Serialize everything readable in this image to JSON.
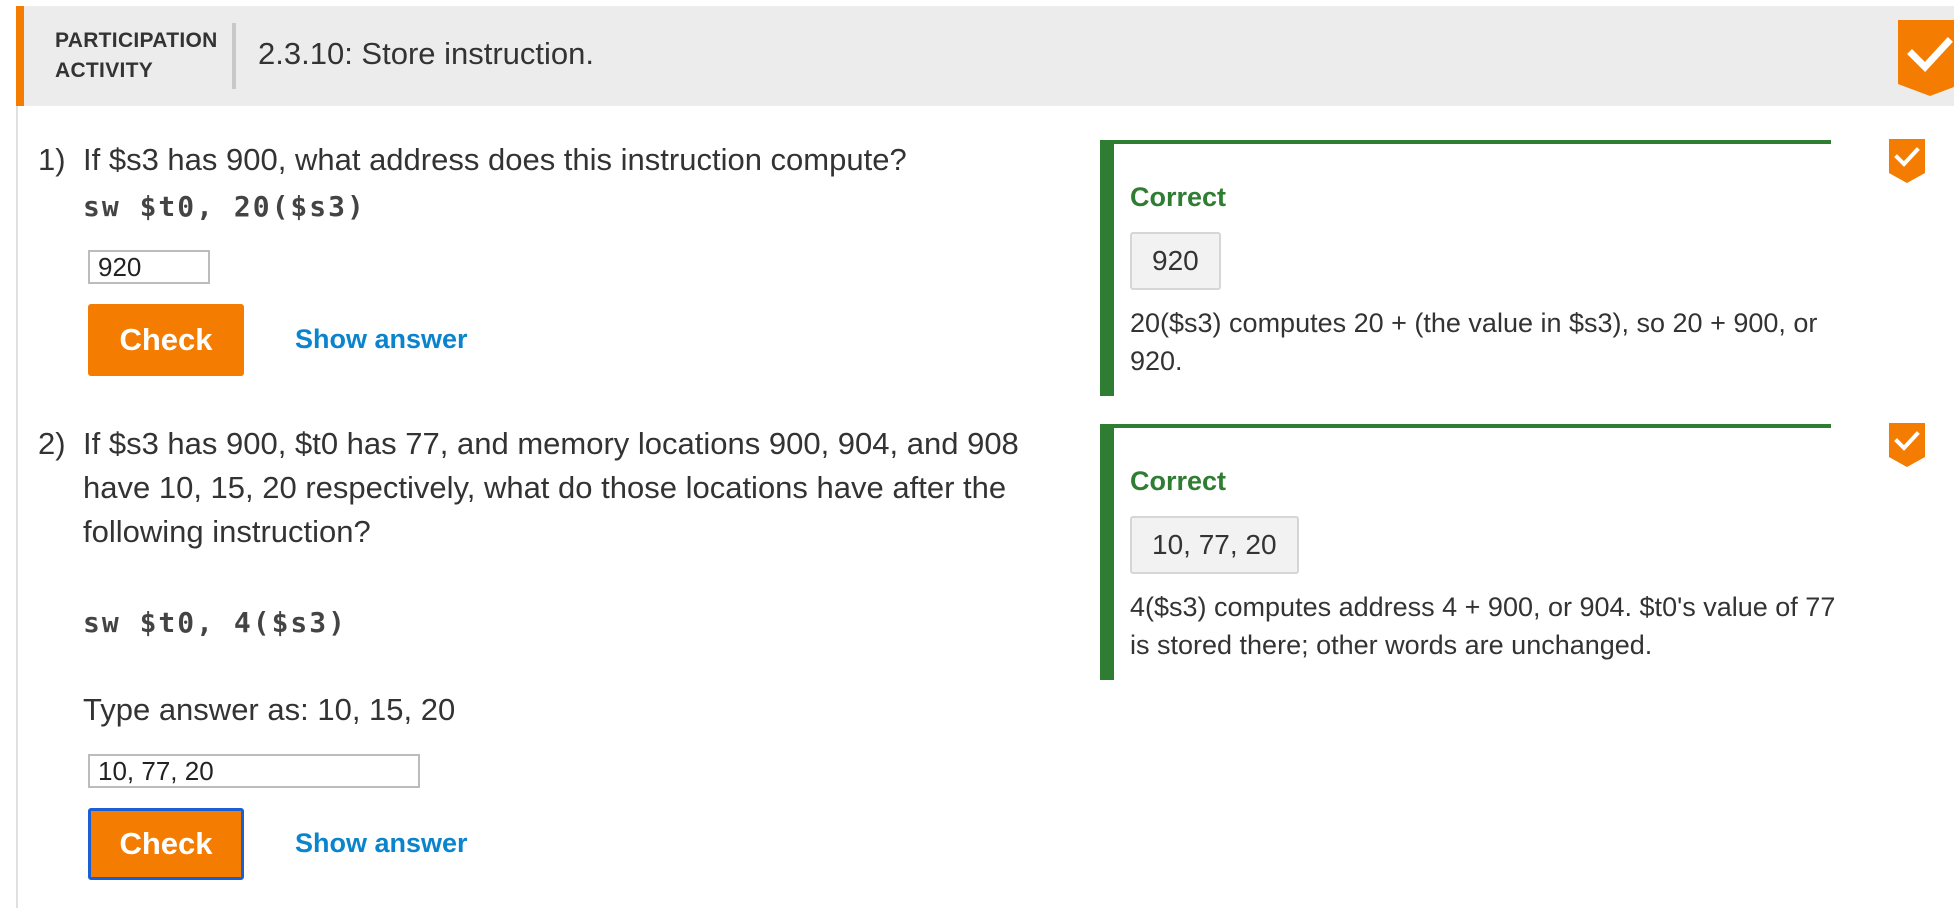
{
  "header": {
    "label_line1": "PARTICIPATION",
    "label_line2": "ACTIVITY",
    "title": "2.3.10: Store instruction.",
    "completed_icon": "check-badge-icon"
  },
  "questions": [
    {
      "number": "1)",
      "text_lines": [
        "If $s3 has 900, what address does this instruction compute?"
      ],
      "code": "sw $t0, 20($s3)",
      "instructions": "",
      "input_value": "920",
      "check_label": "Check",
      "show_answer_label": "Show answer",
      "feedback": {
        "status": "Correct",
        "answer": "920",
        "explanation": "20($s3) computes 20 + (the value in $s3), so 20 + 900, or 920."
      }
    },
    {
      "number": "2)",
      "text_lines": [
        "If $s3 has 900, $t0 has 77, and memory locations 900, 904, and 908",
        "have 10, 15, 20 respectively, what do those locations have after the",
        "following instruction?"
      ],
      "code": "sw $t0, 4($s3)",
      "instructions": "Type answer as: 10, 15, 20",
      "input_value": "10, 77, 20",
      "check_label": "Check",
      "show_answer_label": "Show answer",
      "feedback": {
        "status": "Correct",
        "answer": "10, 77, 20",
        "explanation": "4($s3) computes address 4 + 900, or 904. $t0's value of 77 is stored there; other words are unchanged."
      }
    }
  ],
  "colors": {
    "accent_orange": "#f47c00",
    "correct_green": "#2e7d32",
    "link_blue": "#0a84cc",
    "focus_blue": "#1a5fd6"
  }
}
